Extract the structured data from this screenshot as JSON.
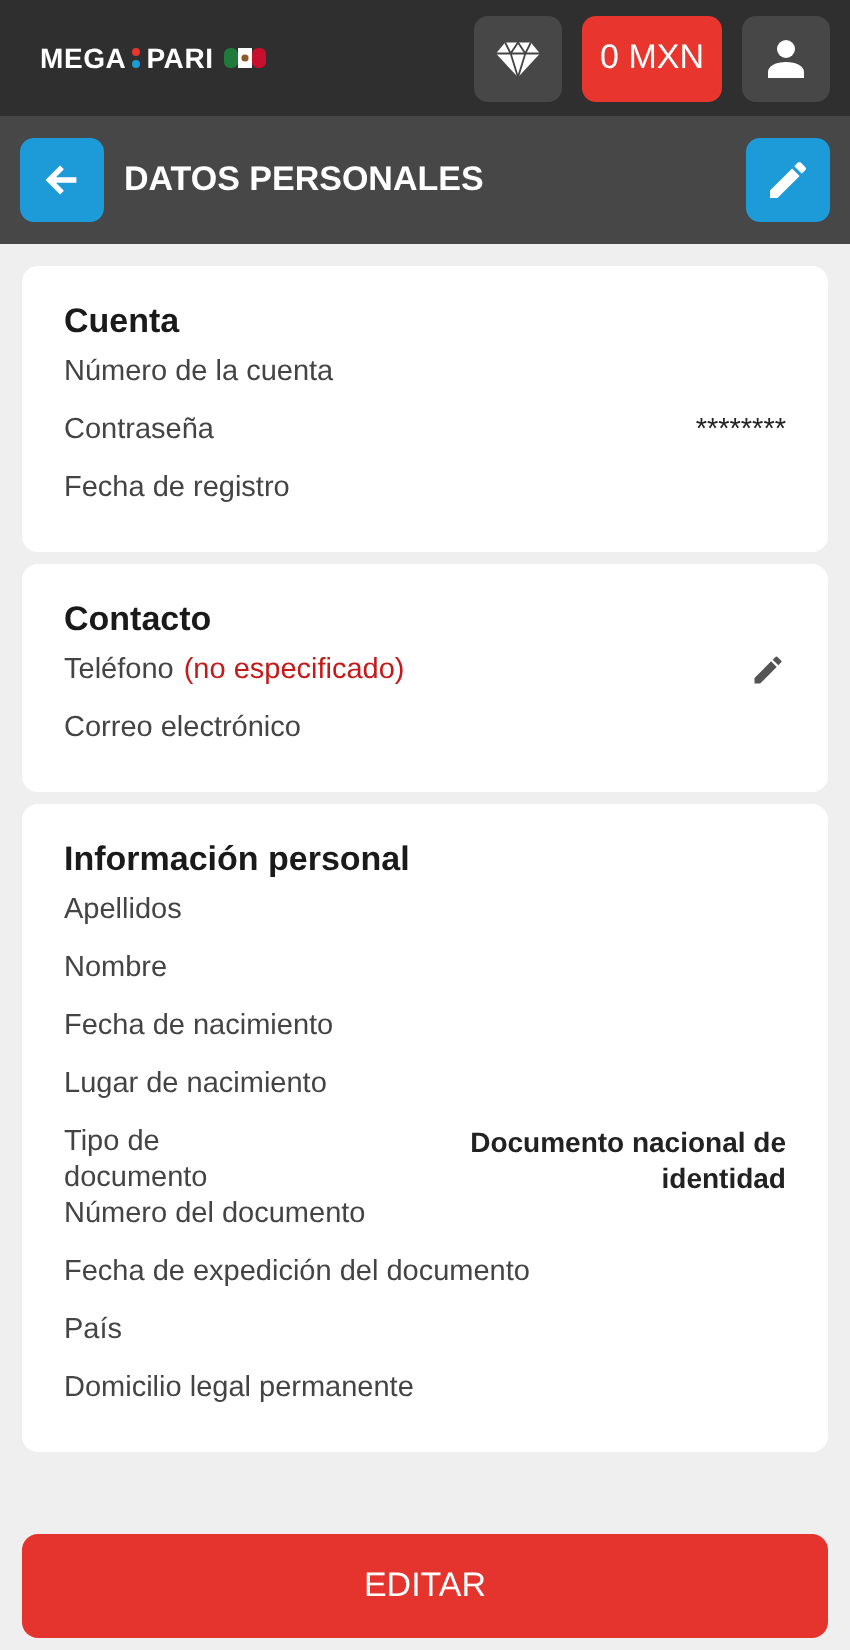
{
  "header": {
    "logo": {
      "left": "MEGA",
      "right": "PARI"
    },
    "balance": "0 MXN"
  },
  "title_bar": {
    "title": "DATOS PERSONALES"
  },
  "sections": [
    {
      "title": "Cuenta",
      "rows": [
        {
          "label": "Número de la cuenta"
        },
        {
          "label": "Contraseña",
          "value": "********",
          "value_bold": false
        },
        {
          "label": "Fecha de registro"
        }
      ]
    },
    {
      "title": "Contacto",
      "rows": [
        {
          "label": "Teléfono",
          "note": "(no especificado)",
          "editable": true
        },
        {
          "label": "Correo electrónico"
        }
      ]
    },
    {
      "title": "Información personal",
      "rows": [
        {
          "label": "Apellidos"
        },
        {
          "label": "Nombre"
        },
        {
          "label": "Fecha de nacimiento"
        },
        {
          "label": "Lugar de nacimiento"
        },
        {
          "label": "Tipo de documento",
          "value": "Documento nacional de identidad",
          "value_bold": true
        },
        {
          "label": "Número del documento"
        },
        {
          "label": "Fecha de expedición del documento"
        },
        {
          "label": "País"
        },
        {
          "label": "Domicilio legal permanente"
        }
      ]
    }
  ],
  "edit_button": "EDITAR"
}
